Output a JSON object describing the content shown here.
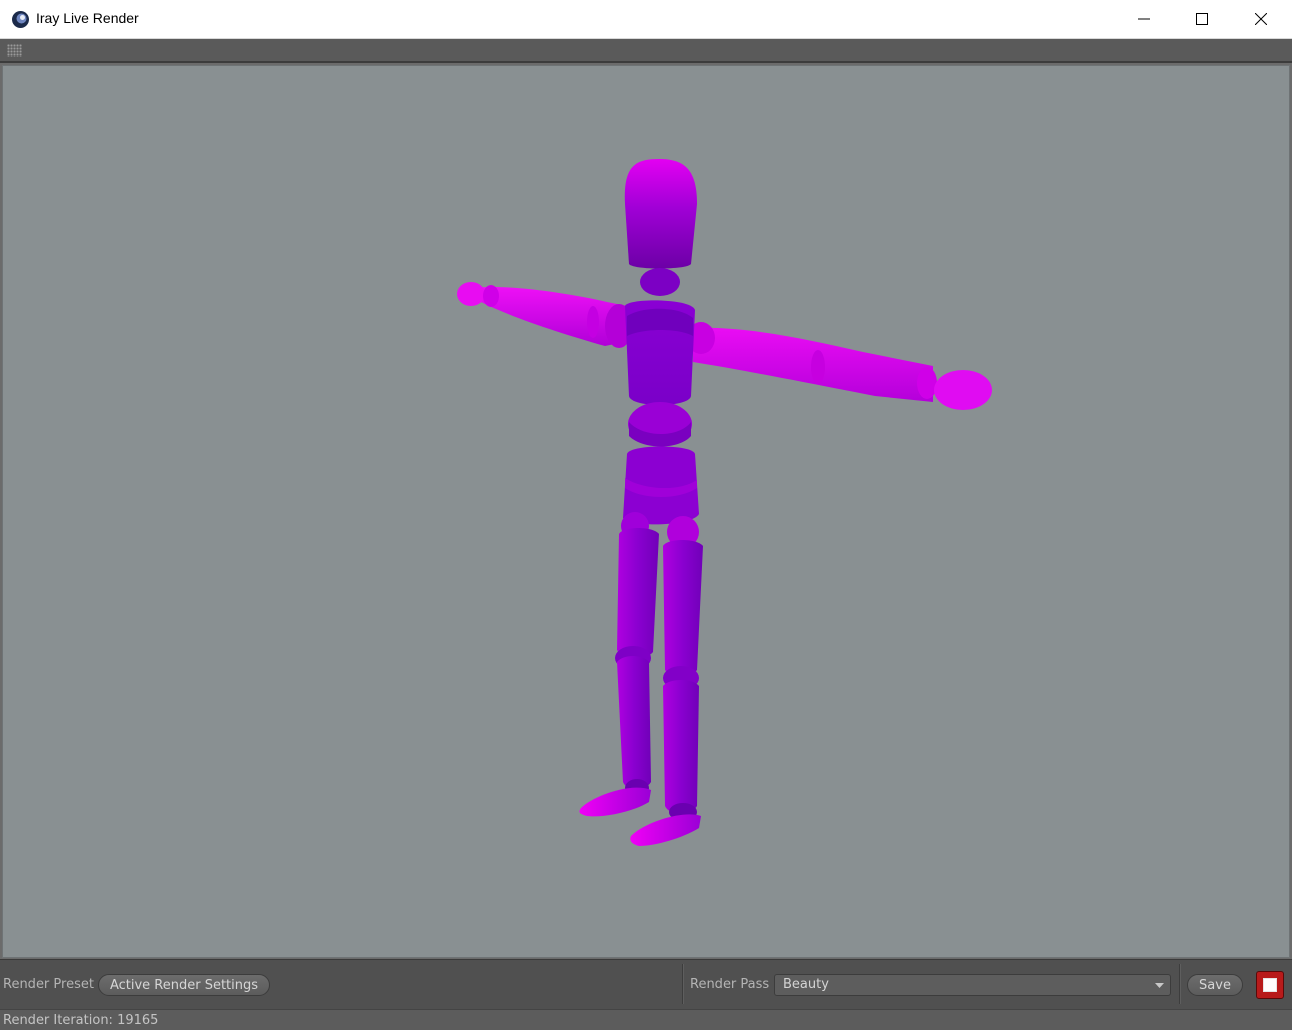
{
  "window": {
    "title": "Iray Live Render",
    "app_icon": "cinema4d-icon",
    "controls": [
      "minimize-icon",
      "maximize-icon",
      "close-icon"
    ]
  },
  "viewport": {
    "background_color": "#899092",
    "figure_color": "#e100f0",
    "figure_shadow_color": "#6a00a8"
  },
  "bottom_bar": {
    "render_preset_label": "Render Preset",
    "render_preset_value": "Active Render Settings",
    "render_pass_label": "Render Pass",
    "render_pass_value": "Beauty",
    "save_label": "Save",
    "stop_color": "#b81b1b"
  },
  "status": {
    "text": "Render Iteration: 19165"
  }
}
